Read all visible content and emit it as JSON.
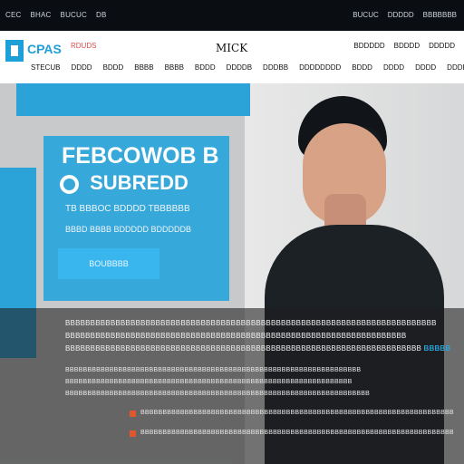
{
  "topbar": {
    "links": [
      "CEC",
      "BHAC",
      "BUCUC",
      "DB"
    ],
    "right": [
      "BUCUC",
      "DDDDD",
      "BBBBBBB"
    ]
  },
  "header": {
    "logo_text": "CPAS",
    "logo_sub": "RDUDS",
    "center_title": "MICK",
    "utility_links": [
      "BDDDDD",
      "BDDDD",
      "DDDDD"
    ],
    "nav": [
      "STECUB",
      "DDDD",
      "BDDD",
      "BBBB",
      "BBBB",
      "BDDD",
      "DDDDB",
      "DDDBB",
      "DDDDDDDD",
      "BDDD",
      "DDDD",
      "DDDD",
      "DDDDB"
    ]
  },
  "hero": {
    "title_line1": "FEBCOWOB B",
    "title_line2": "SUBREDD",
    "subtitle_line1": "TB BBBOC BDDDD  TBBBBBB",
    "subtitle_line2": "BBBD BBBB BDDDDD BDDDDDB",
    "cta_label": "BOUBBBB"
  },
  "overlay": {
    "lines": [
      "BBBBBBBBBBBBBBBBBBBBBBBBBBBBBBBBBBBBBBBBBBBBBBBBBBBBBBBBBBBBBBBBBBBBBBBBBB",
      "BBBBBBBBBBBBBBBBBBBBBBBBBBBBBBBBBBBBBBBBBBBBBBBBBBBBBBBBBBBBBBBBBBBB",
      "BBBBBBBBBBBBBBBBBBBBBBBBBBBBBBBBBBBBBBBBBBBBBBBBBBBBBBBBBBBBBBBBBBBBBBB",
      "BBBBBBBBBBBBBBBBBBBBBBBBBBBBBBBBBBBBBBBBBBBBBBBBBBBBBBBBBBBBBBBBBBB",
      "BBBBBBBBBBBBBBBBBBBBBBBBBBBBBBBBBBBBBBBBBBBBBBBBBBBBBBBBBBBBBBBBB",
      "BBBBBBBBBBBBBBBBBBBBBBBBBBBBBBBBBBBBBBBBBBBBBBBBBBBBBBBBBBBBBBBBBBBBB",
      "BBBBBBBBBBBBBBBBBBBBBBBBBBBBBBBBBBBBBBBBBBBBBBBBBBBBBBBBBBBBBBBBBBBBBBB"
    ],
    "highlight": "BBBBB"
  }
}
